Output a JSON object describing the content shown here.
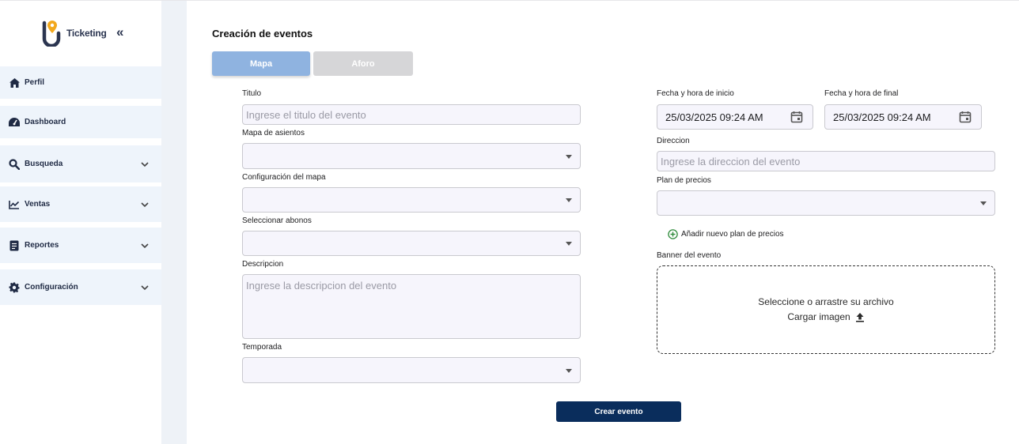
{
  "brand": {
    "name": "Ticketing"
  },
  "sidebar": {
    "items": [
      {
        "label": "Perfil",
        "icon": "home-icon",
        "expandable": false
      },
      {
        "label": "Dashboard",
        "icon": "dashboard-icon",
        "expandable": false
      },
      {
        "label": "Busqueda",
        "icon": "search-icon",
        "expandable": true
      },
      {
        "label": "Ventas",
        "icon": "chart-line-icon",
        "expandable": true
      },
      {
        "label": "Reportes",
        "icon": "report-icon",
        "expandable": true
      },
      {
        "label": "Configuración",
        "icon": "gear-icon",
        "expandable": true
      }
    ]
  },
  "page": {
    "title": "Creación de eventos",
    "tabs": [
      {
        "label": "Mapa",
        "active": true
      },
      {
        "label": "Aforo",
        "active": false
      }
    ]
  },
  "form": {
    "titulo": {
      "label": "Titulo",
      "placeholder": "Ingrese el titulo del evento"
    },
    "mapa_asientos": {
      "label": "Mapa de asientos",
      "value": ""
    },
    "configuracion_mapa": {
      "label": "Configuración del mapa",
      "value": ""
    },
    "abonos": {
      "label": "Seleccionar abonos",
      "value": ""
    },
    "descripcion": {
      "label": "Descripcion",
      "placeholder": "Ingrese la descripcion del evento"
    },
    "temporada": {
      "label": "Temporada",
      "value": ""
    },
    "fecha_inicio": {
      "label": "Fecha y hora de inicio",
      "value": "25/03/2025 09:24 AM"
    },
    "fecha_final": {
      "label": "Fecha y hora de final",
      "value": "25/03/2025 09:24 AM"
    },
    "direccion": {
      "label": "Direccion",
      "placeholder": "Ingrese la direccion del evento"
    },
    "plan_precios": {
      "label": "Plan de precios",
      "value": ""
    },
    "add_plan_label": "Añadir nuevo plan de precios",
    "banner": {
      "label": "Banner del evento",
      "drop_text": "Seleccione o arrastre su archivo",
      "upload_text": "Cargar imagen"
    },
    "submit_label": "Crear evento"
  },
  "colors": {
    "nav_bg": "#eef4fb",
    "tab_active": "#8fb3e0",
    "tab_inactive": "#d6d6d8",
    "submit": "#0a2d5c",
    "logo_accent": "#f2a81d"
  }
}
